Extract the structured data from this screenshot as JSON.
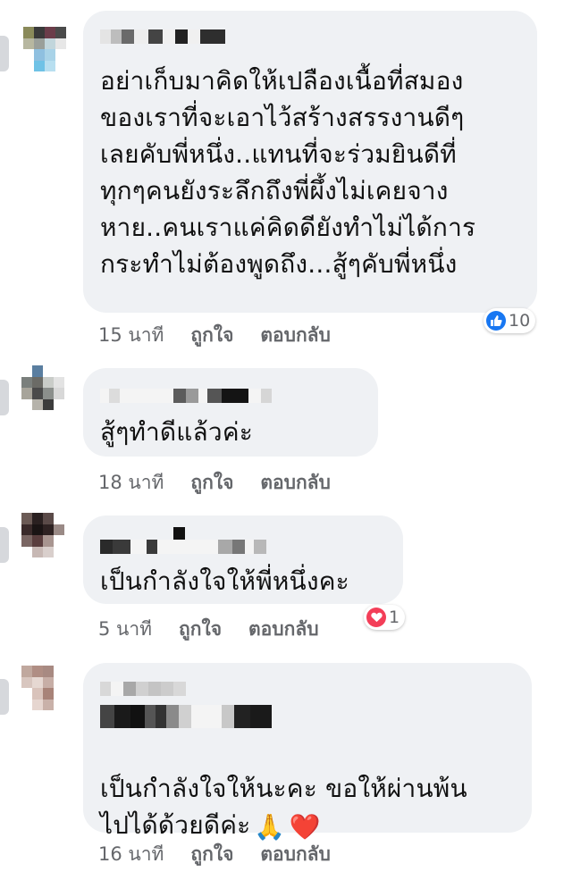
{
  "comments": [
    {
      "text": "อย่าเก็บมาคิดให้เปลืองเนื้อที่สมอง\nของเราที่จะเอาไว้สร้างสรรงานดีๆ\nเลยคับพี่หนึ่ง..แทนที่จะร่วมยินดีที่\nทุกๆคนยังระลึกถึงพี่ผึ้งไม่เคยจาง\nหาย..คนเราแค่คิดดียังทำไม่ได้การ\nกระทำไม่ต้องพูดถึง...สู้ๆคับพี่หนึ่ง",
      "time": "15 นาที",
      "like": "ถูกใจ",
      "reply": "ตอบกลับ",
      "reaction": {
        "icon": "thumbs-up-icon",
        "count": "10"
      }
    },
    {
      "text": "สู้ๆทำดีแล้วค่ะ",
      "time": "18 นาที",
      "like": "ถูกใจ",
      "reply": "ตอบกลับ"
    },
    {
      "text": "เป็นกำลังใจให้พี่หนึ่งคะ",
      "time": "5 นาที",
      "like": "ถูกใจ",
      "reply": "ตอบกลับ",
      "reaction": {
        "icon": "heart-icon",
        "count": "1"
      }
    },
    {
      "text": "เป็นกำลังใจให้นะคะ ขอให้ผ่านพ้น\nไปได้ด้วยดีค่ะ",
      "emojis": [
        "🙏",
        "❤️"
      ],
      "time": "16 นาที",
      "like": "ถูกใจ",
      "reply": "ตอบกลับ"
    }
  ],
  "colors": {
    "bubble": "#eff1f4",
    "meta_text": "#65676b",
    "like_blue": "#1877f2",
    "love_red": "#f33e58"
  }
}
